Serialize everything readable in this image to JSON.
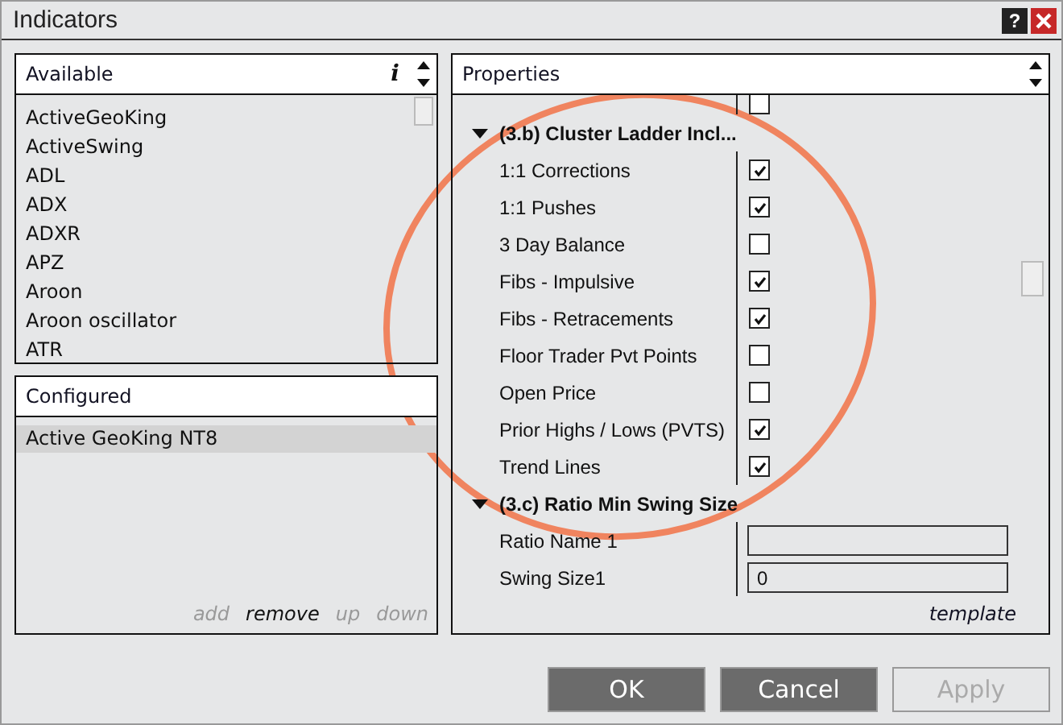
{
  "window": {
    "title": "Indicators",
    "help": "?"
  },
  "available": {
    "title": "Available",
    "info": "i",
    "items": [
      "ActiveGeoKing",
      "ActiveSwing",
      "ADL",
      "ADX",
      "ADXR",
      "APZ",
      "Aroon",
      "Aroon oscillator",
      "ATR"
    ]
  },
  "configured": {
    "title": "Configured",
    "items": [
      {
        "label": "Active GeoKing NT8",
        "selected": true
      }
    ],
    "actions": [
      {
        "label": "add",
        "disabled": true
      },
      {
        "label": "remove",
        "disabled": false
      },
      {
        "label": "up",
        "disabled": true
      },
      {
        "label": "down",
        "disabled": true
      }
    ]
  },
  "properties": {
    "title": "Properties",
    "link": "template",
    "rows": [
      {
        "kind": "partial",
        "checked": false
      },
      {
        "kind": "category",
        "label": "(3.b) Cluster Ladder Incl...",
        "expanded": true
      },
      {
        "kind": "check",
        "label": "1:1 Corrections",
        "checked": true
      },
      {
        "kind": "check",
        "label": "1:1 Pushes",
        "checked": true
      },
      {
        "kind": "check",
        "label": "3 Day Balance",
        "checked": false
      },
      {
        "kind": "check",
        "label": "Fibs - Impulsive",
        "checked": true
      },
      {
        "kind": "check",
        "label": "Fibs - Retracements",
        "checked": true
      },
      {
        "kind": "check",
        "label": "Floor Trader Pvt Points",
        "checked": false
      },
      {
        "kind": "check",
        "label": "Open Price",
        "checked": false
      },
      {
        "kind": "check",
        "label": "Prior Highs / Lows (PVTS)",
        "checked": true
      },
      {
        "kind": "check",
        "label": "Trend Lines",
        "checked": true
      },
      {
        "kind": "category",
        "label": "(3.c) Ratio Min Swing Size",
        "expanded": true
      },
      {
        "kind": "text",
        "label": "Ratio Name 1"
      },
      {
        "kind": "text",
        "label": "Swing Size1",
        "value": "0"
      }
    ]
  },
  "buttons": [
    {
      "label": "OK",
      "disabled": false
    },
    {
      "label": "Cancel",
      "disabled": false
    },
    {
      "label": "Apply",
      "disabled": true
    }
  ]
}
